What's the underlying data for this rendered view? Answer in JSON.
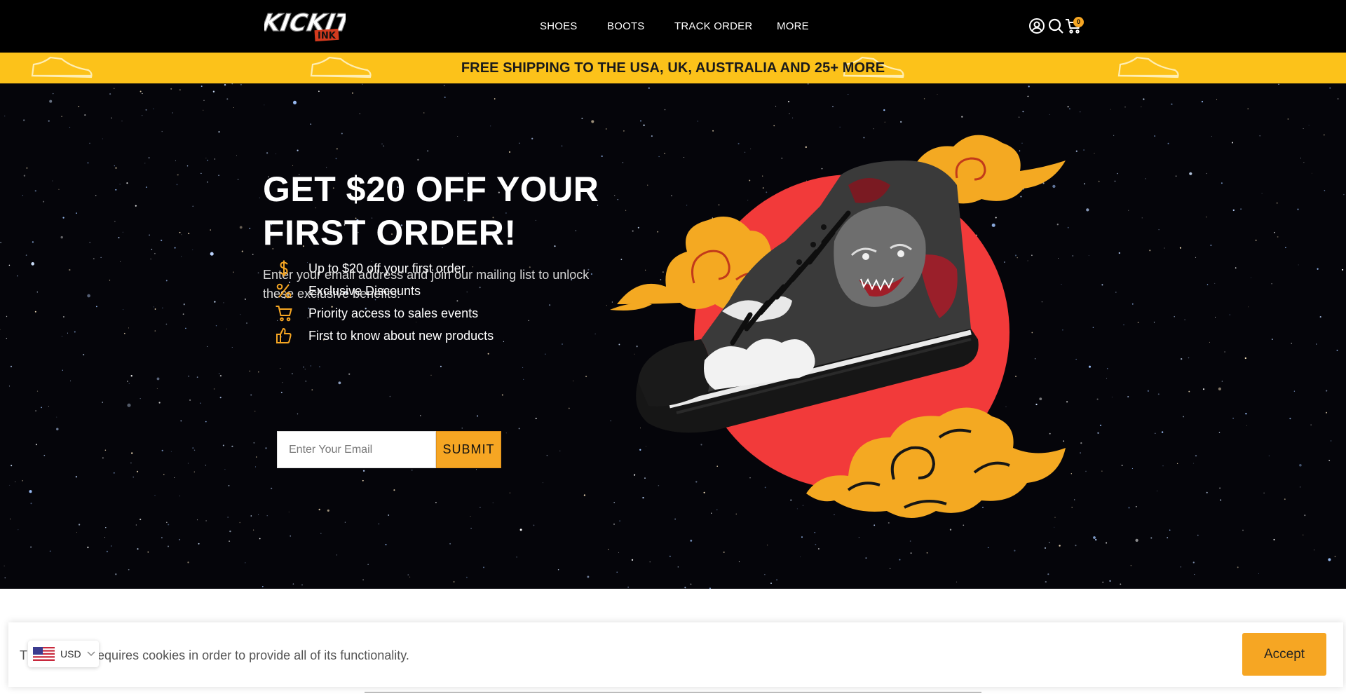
{
  "header": {
    "logo_text": "KICKIT",
    "logo_subtext": "INK",
    "nav": [
      {
        "label": "SHOES"
      },
      {
        "label": "BOOTS"
      },
      {
        "label": "TRACK ORDER"
      },
      {
        "label": "MORE"
      }
    ],
    "cart_count": "0"
  },
  "shipping_bar": {
    "text": "FREE SHIPPING TO THE USA, UK, AUSTRALIA AND 25+ MORE"
  },
  "hero": {
    "title": "GET $20 OFF YOUR FIRST ORDER!",
    "subtitle": "Enter your email address and join our mailing list to unlock these exclusive benefits:",
    "benefits": [
      {
        "icon": "dollar-icon",
        "text": "Up to $20 off your first order"
      },
      {
        "icon": "percent-icon",
        "text": "Exclusive Discounts"
      },
      {
        "icon": "cart-icon",
        "text": "Priority access to sales events"
      },
      {
        "icon": "thumbs-up-icon",
        "text": "First to know about new products"
      }
    ],
    "email_placeholder": "Enter Your Email",
    "submit_label": "SUBMIT"
  },
  "cookie_bar": {
    "text": "This website requires cookies in order to provide all of its functionality.",
    "accept_label": "Accept"
  },
  "currency": {
    "label": "USD"
  },
  "colors": {
    "accent": "#f6a623",
    "shipping_bar": "#fcc21a",
    "header_bg": "#000000",
    "sun_red": "#f23a3a"
  }
}
